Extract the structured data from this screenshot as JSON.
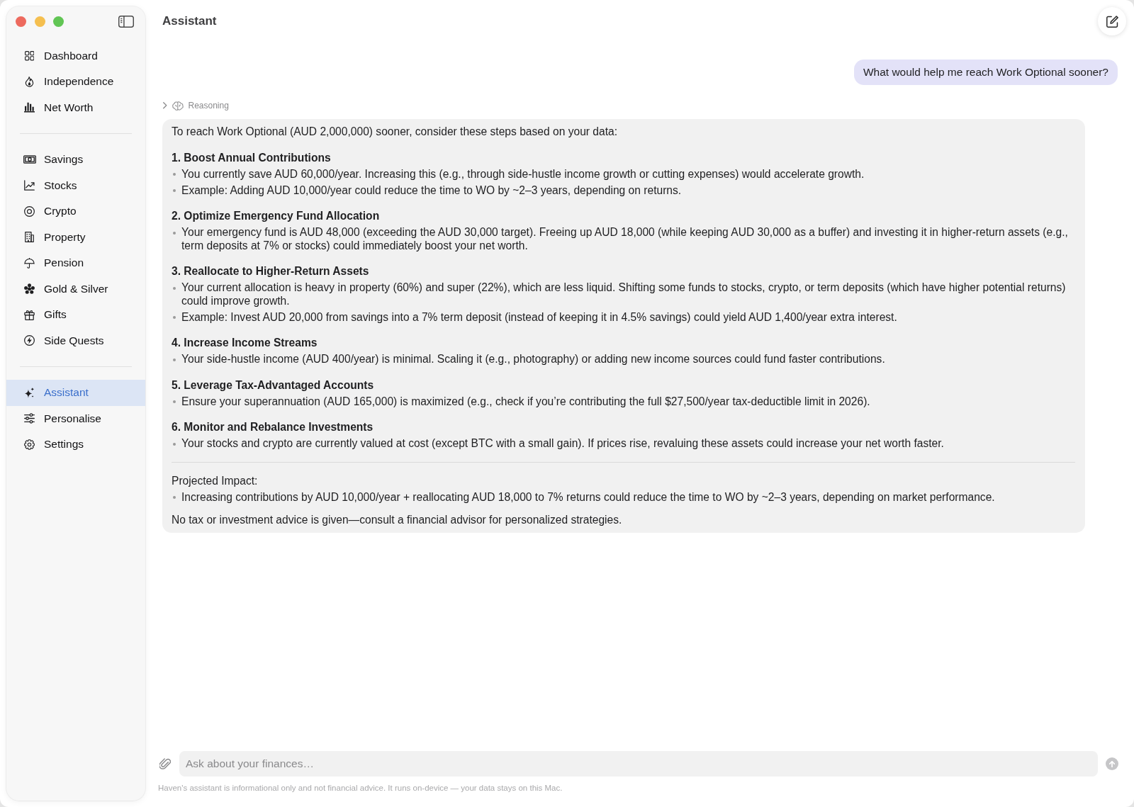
{
  "header": {
    "title": "Assistant"
  },
  "sidebar": {
    "sections": [
      {
        "items": [
          {
            "label": "Dashboard",
            "selected": false
          },
          {
            "label": "Independence",
            "selected": false
          },
          {
            "label": "Net Worth",
            "selected": false
          }
        ]
      },
      {
        "items": [
          {
            "label": "Savings",
            "selected": false
          },
          {
            "label": "Stocks",
            "selected": false
          },
          {
            "label": "Crypto",
            "selected": false
          },
          {
            "label": "Property",
            "selected": false
          },
          {
            "label": "Pension",
            "selected": false
          },
          {
            "label": "Gold & Silver",
            "selected": false
          },
          {
            "label": "Gifts",
            "selected": false
          },
          {
            "label": "Side Quests",
            "selected": false
          }
        ]
      },
      {
        "items": [
          {
            "label": "Assistant",
            "selected": true
          },
          {
            "label": "Personalise",
            "selected": false
          },
          {
            "label": "Settings",
            "selected": false
          }
        ]
      }
    ]
  },
  "conversation": {
    "user_message": "What would help me reach Work Optional sooner?",
    "reasoning": {
      "label": "Reasoning",
      "expanded": false
    },
    "reply": {
      "intro": "To reach Work Optional (AUD 2,000,000) sooner, consider these steps based on your data:",
      "sections": [
        {
          "heading": "1. Boost Annual Contributions",
          "bullets": [
            "You currently save AUD 60,000/year. Increasing this (e.g., through side-hustle income growth or cutting expenses) would accelerate growth.",
            "Example: Adding AUD 10,000/year could reduce the time to WO by ~2–3 years, depending on returns."
          ]
        },
        {
          "heading": "2. Optimize Emergency Fund Allocation",
          "bullets": [
            "Your emergency fund is AUD 48,000 (exceeding the AUD 30,000 target). Freeing up AUD 18,000 (while keeping AUD 30,000 as a buffer) and investing it in higher-return assets (e.g., term deposits at 7% or stocks) could immediately boost your net worth."
          ]
        },
        {
          "heading": "3. Reallocate to Higher-Return Assets",
          "bullets": [
            "Your current allocation is heavy in property (60%) and super (22%), which are less liquid. Shifting some funds to stocks, crypto, or term deposits (which have higher potential returns) could improve growth.",
            "Example: Invest AUD 20,000 from savings into a 7% term deposit (instead of keeping it in 4.5% savings) could yield AUD 1,400/year extra interest."
          ]
        },
        {
          "heading": "4. Increase Income Streams",
          "bullets": [
            "Your side-hustle income (AUD 400/year) is minimal. Scaling it (e.g., photography) or adding new income sources could fund faster contributions."
          ]
        },
        {
          "heading": "5. Leverage Tax-Advantaged Accounts",
          "bullets": [
            "Ensure your superannuation (AUD 165,000) is maximized (e.g., check if you’re contributing the full $27,500/year tax-deductible limit in 2026)."
          ]
        },
        {
          "heading": "6. Monitor and Rebalance Investments",
          "bullets": [
            "Your stocks and crypto are currently valued at cost (except BTC with a small gain). If prices rise, revaluing these assets could increase your net worth faster."
          ]
        }
      ],
      "impact": {
        "heading": "Projected Impact:",
        "bullets": [
          "Increasing contributions by AUD 10,000/year + reallocating AUD 18,000 to 7% returns could reduce the time to WO by ~2–3 years, depending on market performance."
        ]
      },
      "closing": "No tax or investment advice is given—consult a financial advisor for personalized strategies."
    }
  },
  "composer": {
    "placeholder": "Ask about your finances…",
    "send_button": {
      "disabled": true
    },
    "disclaimer": "Haven's assistant is informational only and not financial advice. It runs on-device — your data stays on this Mac."
  }
}
